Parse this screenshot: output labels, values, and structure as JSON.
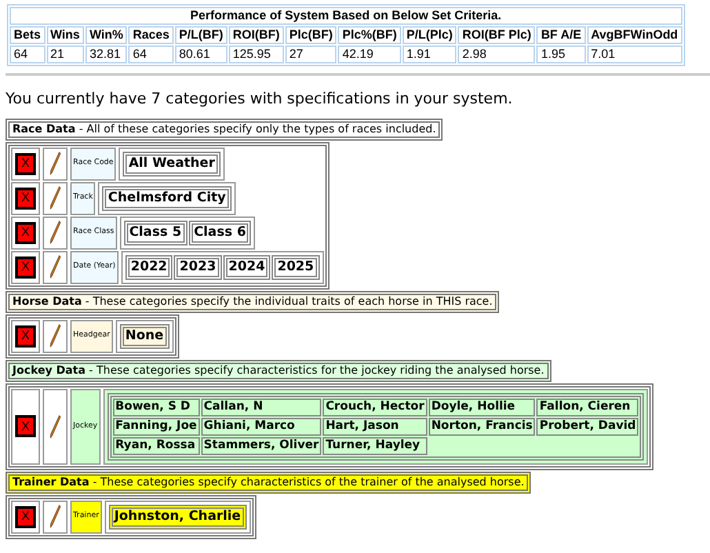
{
  "performance": {
    "title": "Performance of System Based on Below Set Criteria.",
    "columns": [
      "Bets",
      "Wins",
      "Win%",
      "Races",
      "P/L(BF)",
      "ROI(BF)",
      "Plc(BF)",
      "Plc%(BF)",
      "P/L(Plc)",
      "ROI(BF Plc)",
      "BF A/E",
      "AvgBFWinOdd"
    ],
    "values": [
      "64",
      "21",
      "32.81",
      "64",
      "80.61",
      "125.95",
      "27",
      "42.19",
      "1.91",
      "2.98",
      "1.95",
      "7.01"
    ]
  },
  "summary": "You currently have 7 categories with specifications in your system.",
  "sections": [
    {
      "kind": "race",
      "heading": "**Race Data** - All of these categories specify only the types of races included.",
      "categories": [
        {
          "delete": "X",
          "label": "Race Code",
          "values": [
            "All Weather"
          ]
        },
        {
          "delete": "X",
          "label": "Track",
          "values": [
            "Chelmsford City"
          ]
        },
        {
          "delete": "X",
          "label": "Race Class",
          "values": [
            "Class 5",
            "Class 6"
          ]
        },
        {
          "delete": "X",
          "label": "Date (Year)",
          "values": [
            "2022",
            "2023",
            "2024",
            "2025"
          ]
        }
      ]
    },
    {
      "kind": "horse",
      "heading": "**Horse Data** - These categories specify the individual traits of each horse in THIS race.",
      "categories": [
        {
          "delete": "X",
          "label": "Headgear",
          "values": [
            "None"
          ]
        }
      ]
    },
    {
      "kind": "jockey",
      "heading": "**Jockey Data** - These categories specify characteristics for the jockey riding the analysed horse.",
      "categories": [
        {
          "delete": "X",
          "label": "Jockey",
          "values": [
            "Bowen, S D",
            "Callan, N",
            "Crouch, Hector",
            "Doyle, Hollie",
            "Fallon, Cieren",
            "Fanning, Joe",
            "Ghiani, Marco",
            "Hart, Jason",
            "Norton, Francis",
            "Probert, David",
            "Ryan, Rossa",
            "Stammers, Oliver",
            "Turner, Hayley"
          ]
        }
      ]
    },
    {
      "kind": "trainer",
      "heading": "**Trainer Data** - These categories specify characteristics of the trainer of the analysed horse.",
      "categories": [
        {
          "delete": "X",
          "label": "Trainer",
          "values": [
            "Johnston, Charlie"
          ]
        }
      ]
    }
  ]
}
